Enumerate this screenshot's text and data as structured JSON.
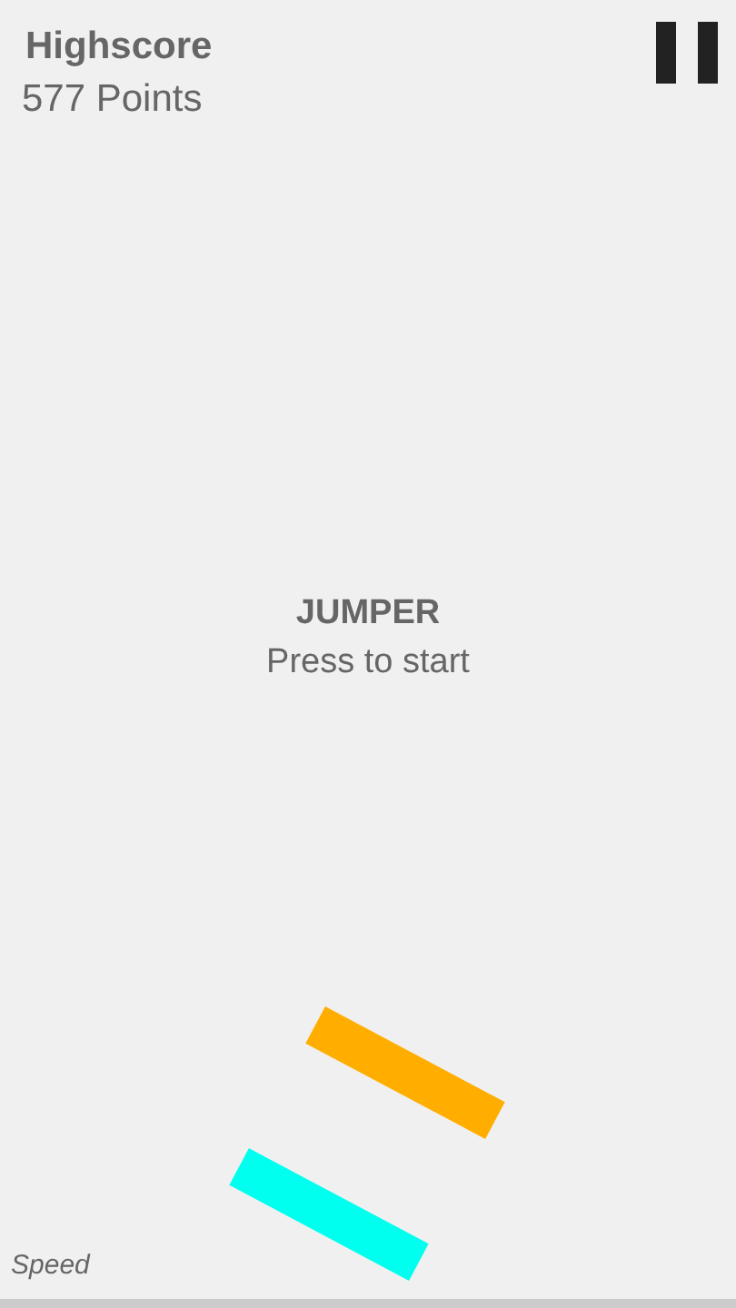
{
  "highscore": {
    "label": "Highscore",
    "value": "577 Points"
  },
  "title": "JUMPER",
  "prompt": "Press to start",
  "platforms": [
    {
      "color": "#ffae00"
    },
    {
      "color": "#00ffee"
    }
  ],
  "speed": {
    "label": "Speed"
  }
}
